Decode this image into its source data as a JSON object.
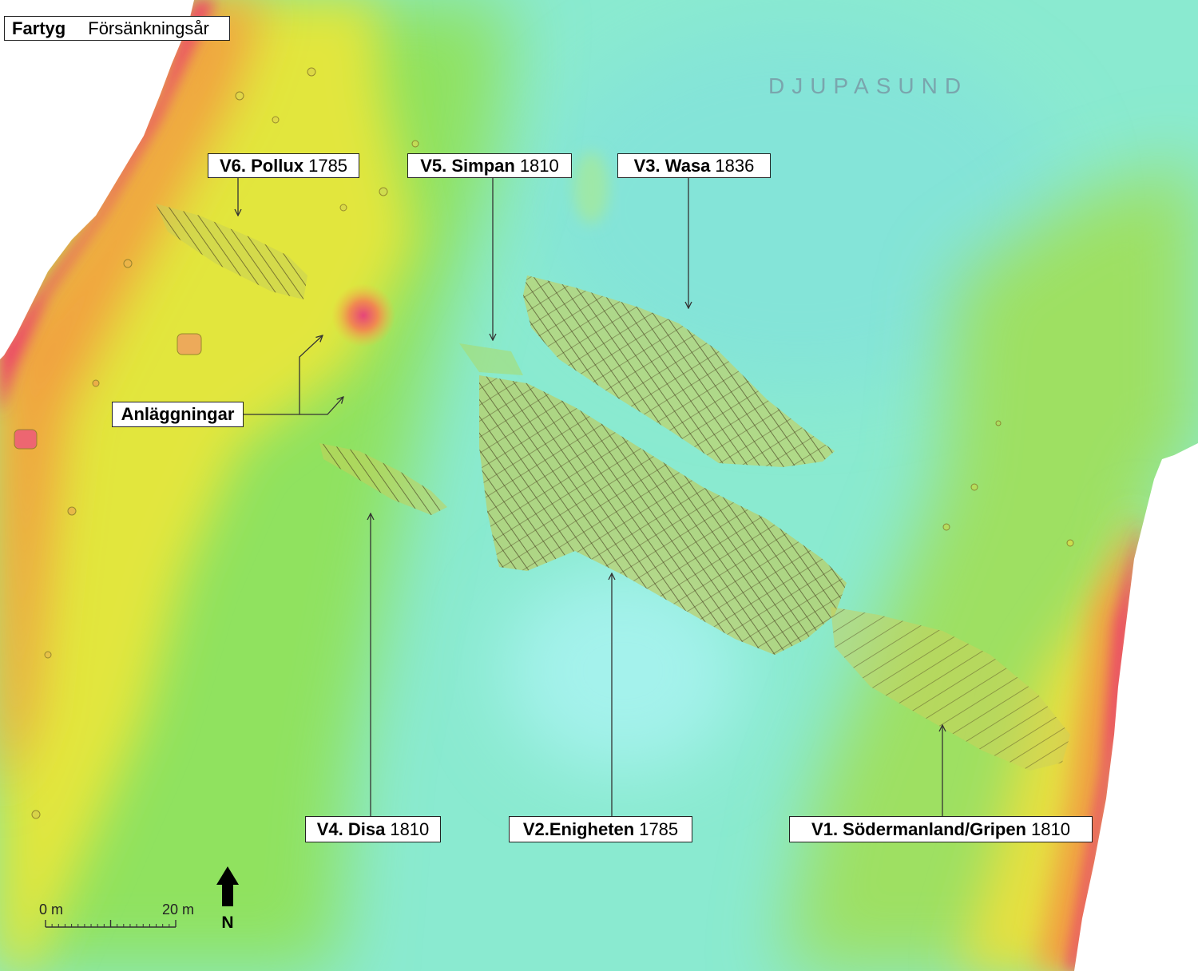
{
  "legend": {
    "vessel_label": "Fartyg",
    "year_label": "Försänkningsår"
  },
  "area_name": "DJUPASUND",
  "wrecks": [
    {
      "label": "V1. Södermanland/Gripen",
      "year": "1810"
    },
    {
      "label": "V2.Enigheten",
      "year": "1785"
    },
    {
      "label": "V3. Wasa",
      "year": "1836"
    },
    {
      "label": "V4. Disa",
      "year": "1810"
    },
    {
      "label": "V5. Simpan",
      "year": "1810"
    },
    {
      "label": "V6. Pollux",
      "year": "1785"
    }
  ],
  "features": {
    "installations": "Anläggningar"
  },
  "scale_bar": {
    "start_label": "0 m",
    "end_label": "20 m"
  },
  "north_arrow": {
    "label": "N"
  },
  "colors": {
    "area_name": "#7aa5ad",
    "label_background": "#ffffff",
    "label_border": "#222222",
    "leader_line": "#333333",
    "deep_water": "#8aead0",
    "shallow_shore": "#ee4468"
  }
}
